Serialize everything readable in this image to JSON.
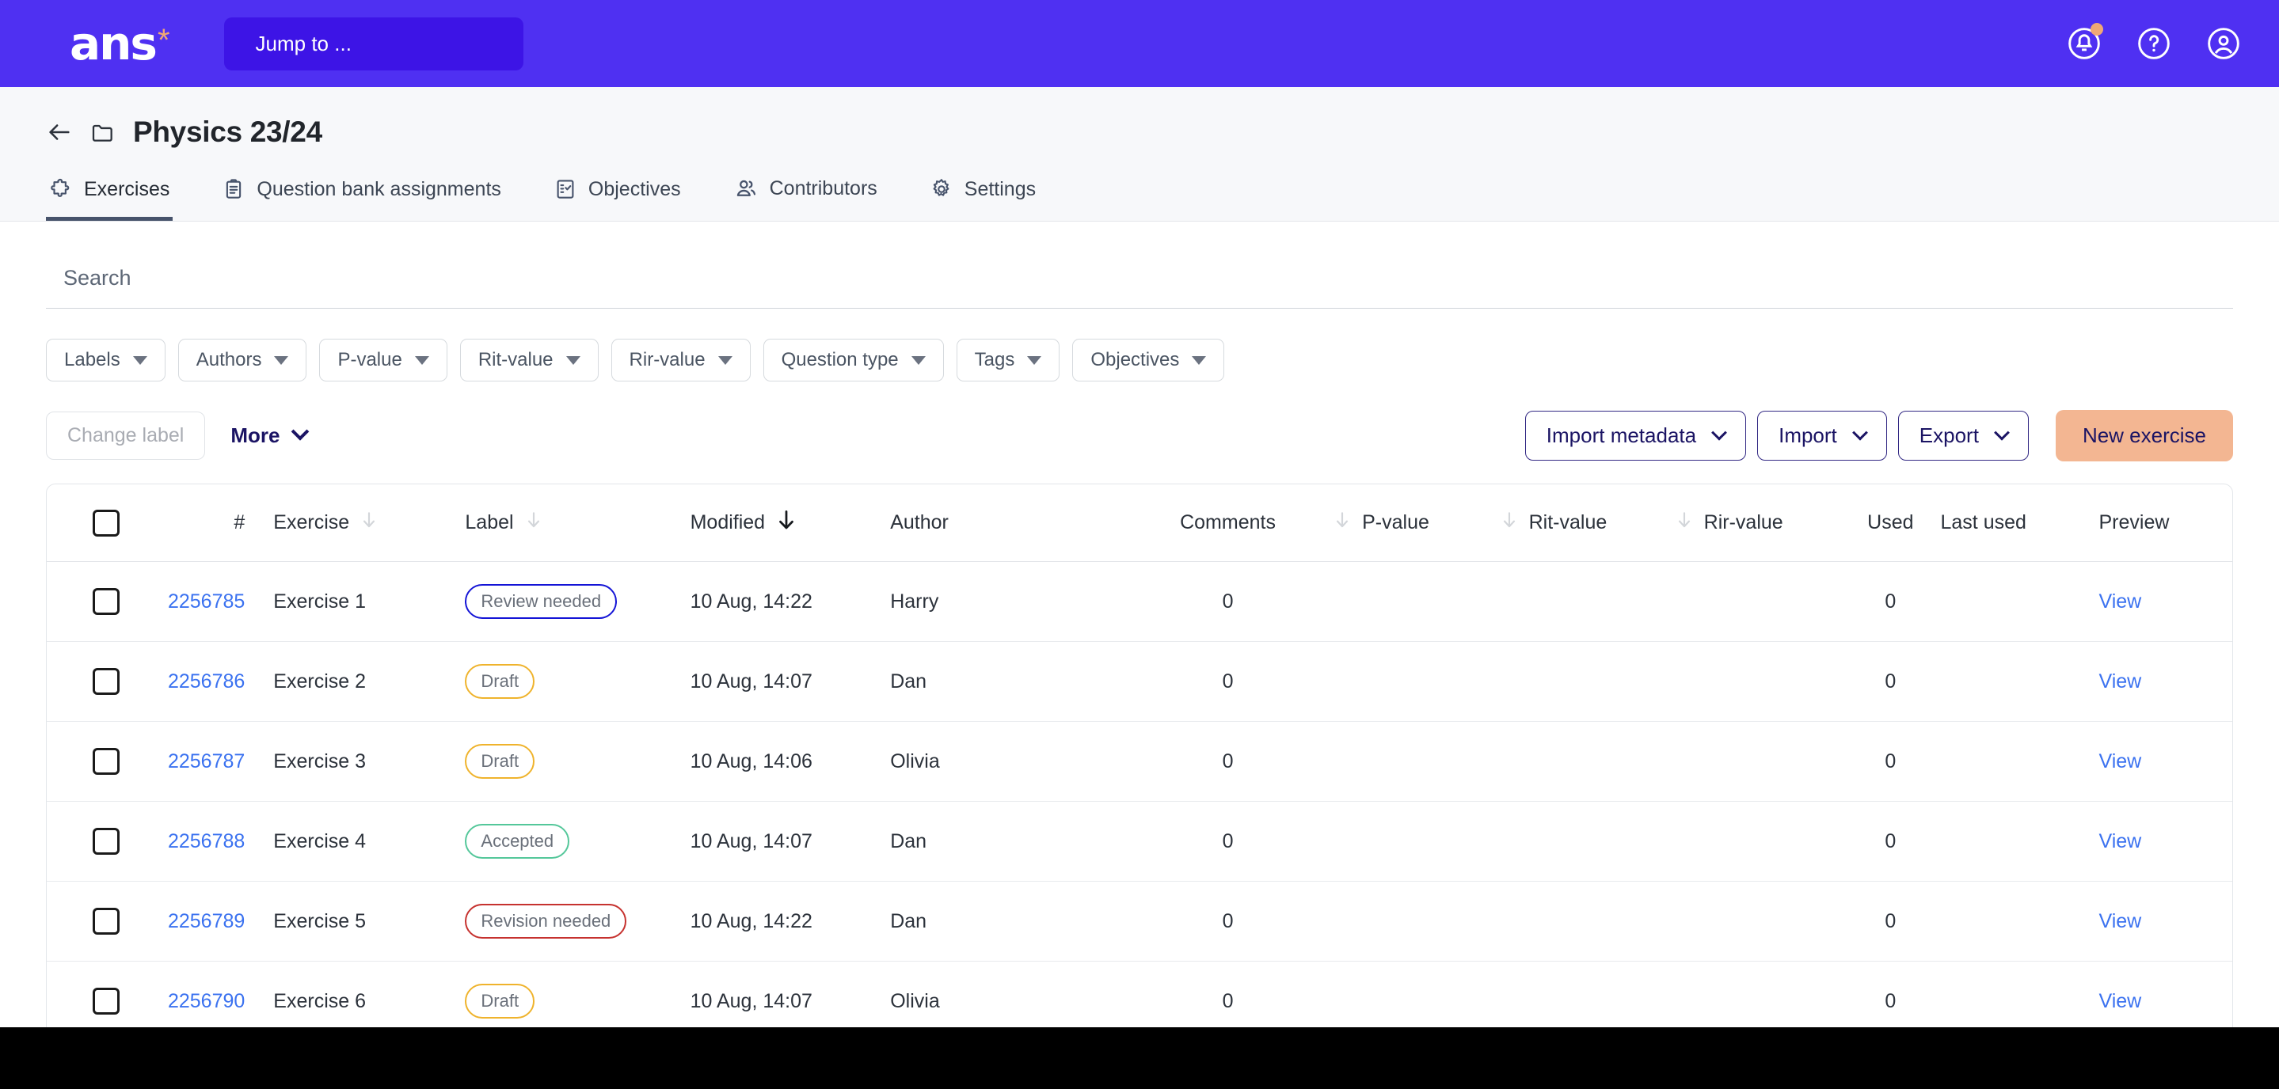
{
  "topbar": {
    "logo_text": "ans",
    "logo_star": "*",
    "jump_to_label": "Jump to ...",
    "icons": [
      {
        "name": "notifications-icon",
        "has_dot": true
      },
      {
        "name": "help-icon",
        "has_dot": false
      },
      {
        "name": "account-icon",
        "has_dot": false
      }
    ]
  },
  "header": {
    "back_label": "back",
    "title": "Physics 23/24",
    "tabs": [
      {
        "label": "Exercises",
        "icon": "puzzle-icon",
        "active": true
      },
      {
        "label": "Question bank assignments",
        "icon": "clipboard-icon",
        "active": false
      },
      {
        "label": "Objectives",
        "icon": "checklist-icon",
        "active": false
      },
      {
        "label": "Contributors",
        "icon": "people-icon",
        "active": false
      },
      {
        "label": "Settings",
        "icon": "gear-icon",
        "active": false
      }
    ]
  },
  "search": {
    "placeholder": "Search",
    "value": ""
  },
  "filters": [
    {
      "label": "Labels"
    },
    {
      "label": "Authors"
    },
    {
      "label": "P-value"
    },
    {
      "label": "Rit-value"
    },
    {
      "label": "Rir-value"
    },
    {
      "label": "Question type"
    },
    {
      "label": "Tags"
    },
    {
      "label": "Objectives"
    }
  ],
  "actions": {
    "change_label": "Change label",
    "more": "More",
    "import_metadata": "Import metadata",
    "import": "Import",
    "export": "Export",
    "new_exercise": "New exercise"
  },
  "table": {
    "columns": [
      {
        "key": "check",
        "label": "",
        "sortable": false,
        "sort_active": false,
        "arrow_before": false
      },
      {
        "key": "id",
        "label": "#",
        "sortable": false,
        "sort_active": false,
        "arrow_before": false
      },
      {
        "key": "exercise",
        "label": "Exercise",
        "sortable": true,
        "sort_active": false,
        "arrow_before": false
      },
      {
        "key": "label",
        "label": "Label",
        "sortable": true,
        "sort_active": false,
        "arrow_before": false
      },
      {
        "key": "modified",
        "label": "Modified",
        "sortable": true,
        "sort_active": true,
        "arrow_before": false
      },
      {
        "key": "author",
        "label": "Author",
        "sortable": false,
        "sort_active": false,
        "arrow_before": false
      },
      {
        "key": "comments",
        "label": "Comments",
        "sortable": false,
        "sort_active": false,
        "arrow_before": false
      },
      {
        "key": "pvalue",
        "label": "P-value",
        "sortable": true,
        "sort_active": false,
        "arrow_before": true
      },
      {
        "key": "ritvalue",
        "label": "Rit-value",
        "sortable": true,
        "sort_active": false,
        "arrow_before": true
      },
      {
        "key": "rirvalue",
        "label": "Rir-value",
        "sortable": true,
        "sort_active": false,
        "arrow_before": true
      },
      {
        "key": "used",
        "label": "Used",
        "sortable": false,
        "sort_active": false,
        "arrow_before": false
      },
      {
        "key": "lastused",
        "label": "Last used",
        "sortable": false,
        "sort_active": false,
        "arrow_before": false
      },
      {
        "key": "preview",
        "label": "Preview",
        "sortable": false,
        "sort_active": false,
        "arrow_before": false
      }
    ],
    "view_link_label": "View",
    "rows": [
      {
        "id": "2256785",
        "exercise": "Exercise 1",
        "label": "Review needed",
        "label_kind": "review",
        "modified": "10 Aug, 14:22",
        "author": "Harry",
        "comments": "0",
        "pvalue": "",
        "ritvalue": "",
        "rirvalue": "",
        "used": "0",
        "lastused": ""
      },
      {
        "id": "2256786",
        "exercise": "Exercise 2",
        "label": "Draft",
        "label_kind": "draft",
        "modified": "10 Aug, 14:07",
        "author": "Dan",
        "comments": "0",
        "pvalue": "",
        "ritvalue": "",
        "rirvalue": "",
        "used": "0",
        "lastused": ""
      },
      {
        "id": "2256787",
        "exercise": "Exercise 3",
        "label": "Draft",
        "label_kind": "draft",
        "modified": "10 Aug, 14:06",
        "author": "Olivia",
        "comments": "0",
        "pvalue": "",
        "ritvalue": "",
        "rirvalue": "",
        "used": "0",
        "lastused": ""
      },
      {
        "id": "2256788",
        "exercise": "Exercise 4",
        "label": "Accepted",
        "label_kind": "accepted",
        "modified": "10 Aug, 14:07",
        "author": "Dan",
        "comments": "0",
        "pvalue": "",
        "ritvalue": "",
        "rirvalue": "",
        "used": "0",
        "lastused": ""
      },
      {
        "id": "2256789",
        "exercise": "Exercise 5",
        "label": "Revision needed",
        "label_kind": "revision",
        "modified": "10 Aug, 14:22",
        "author": "Dan",
        "comments": "0",
        "pvalue": "",
        "ritvalue": "",
        "rirvalue": "",
        "used": "0",
        "lastused": ""
      },
      {
        "id": "2256790",
        "exercise": "Exercise 6",
        "label": "Draft",
        "label_kind": "draft",
        "modified": "10 Aug, 14:07",
        "author": "Olivia",
        "comments": "0",
        "pvalue": "",
        "ritvalue": "",
        "rirvalue": "",
        "used": "0",
        "lastused": ""
      }
    ]
  },
  "colors": {
    "brand_purple": "#4f30f2",
    "jump_to_bg": "#3d14e6",
    "accent_peach": "#f3b692",
    "link_blue": "#3b72f0",
    "navy": "#1b1464",
    "pill_review": "#1414d6",
    "pill_draft": "#efb32c",
    "pill_accepted": "#54c79a",
    "pill_revision": "#c6322f"
  }
}
